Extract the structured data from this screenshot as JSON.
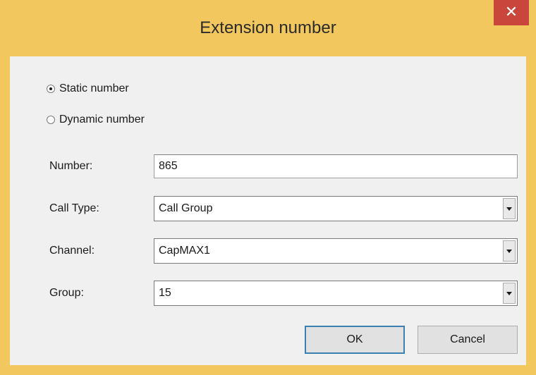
{
  "window": {
    "title": "Extension number",
    "close_glyph": "✕",
    "frame_color": "#f2c75e",
    "close_color": "#c9463d"
  },
  "mode": {
    "options": [
      {
        "label": "Static number",
        "checked": true
      },
      {
        "label": "Dynamic number",
        "checked": false
      }
    ]
  },
  "form": {
    "number_label": "Number:",
    "number_value": "865",
    "call_type_label": "Call Type:",
    "call_type_value": "Call Group",
    "channel_label": "Channel:",
    "channel_value": "CapMAX1",
    "group_label": "Group:",
    "group_value": "15"
  },
  "buttons": {
    "ok_label": "OK",
    "cancel_label": "Cancel"
  },
  "icons": {
    "dropdown": "chevron-down-icon",
    "close": "close-icon"
  }
}
